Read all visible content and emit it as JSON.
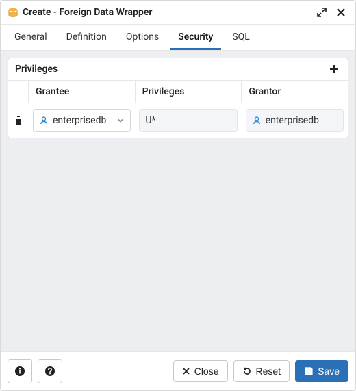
{
  "titlebar": {
    "title": "Create - Foreign Data Wrapper"
  },
  "tabs": {
    "general": "General",
    "definition": "Definition",
    "options": "Options",
    "security": "Security",
    "sql": "SQL"
  },
  "privileges": {
    "section_title": "Privileges",
    "columns": {
      "grantee": "Grantee",
      "privileges": "Privileges",
      "grantor": "Grantor"
    },
    "rows": [
      {
        "grantee": "enterprisedb",
        "privileges": "U*",
        "grantor": "enterprisedb"
      }
    ]
  },
  "footer": {
    "close": "Close",
    "reset": "Reset",
    "save": "Save"
  }
}
